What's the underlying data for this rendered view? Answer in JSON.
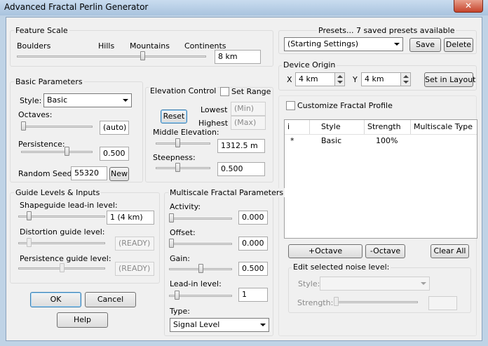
{
  "window": {
    "title": "Advanced Fractal Perlin Generator",
    "close_label": "✕"
  },
  "feature_scale": {
    "title": "Feature Scale",
    "ticks": [
      "Boulders",
      "Hills",
      "Mountains",
      "Continents"
    ],
    "value": "8 km",
    "slider_level": 0.67
  },
  "presets": {
    "title": "Presets... 7 saved presets available",
    "selected": "(Starting Settings)",
    "save_label": "Save",
    "delete_label": "Delete"
  },
  "device_origin": {
    "title": "Device Origin",
    "x_label": "X",
    "x_value": "4 km",
    "y_label": "Y",
    "y_value": "4 km",
    "set_in_layout_label": "Set in Layout"
  },
  "basic": {
    "title": "Basic Parameters",
    "style_label": "Style:",
    "style_value": "Basic",
    "octaves_label": "Octaves:",
    "octaves_value": "(auto)",
    "octaves_level": 0.0,
    "persistence_label": "Persistence:",
    "persistence_value": "0.500",
    "persistence_level": 0.65,
    "seed_label": "Random Seed:",
    "seed_value": "55320",
    "new_label": "New"
  },
  "elevation": {
    "title": "Elevation Control",
    "set_range_label": "Set Range",
    "reset_label": "Reset",
    "lowest_label": "Lowest",
    "lowest_value": "(Min)",
    "highest_label": "Highest",
    "highest_value": "(Max)",
    "middle_label": "Middle Elevation:",
    "middle_value": "1312.5 m",
    "middle_level": 0.4,
    "steepness_label": "Steepness:",
    "steepness_value": "0.500",
    "steepness_level": 0.4
  },
  "customize": {
    "label": "Customize Fractal Profile",
    "columns": [
      "i",
      "Style",
      "Strength",
      "Multiscale Type"
    ],
    "rows": [
      {
        "i": "*",
        "style": "Basic",
        "strength": "100%",
        "type": ""
      }
    ],
    "add_octave_label": "+Octave",
    "remove_octave_label": "-Octave",
    "clear_all_label": "Clear All",
    "edit_title": "Edit selected noise level:",
    "edit_style_label": "Style:",
    "edit_strength_label": "Strength:"
  },
  "guide": {
    "title": "Guide Levels & Inputs",
    "shapeguide_label": "Shapeguide lead-in level:",
    "shapeguide_value": "1 (4 km)",
    "shapeguide_level": 0.1,
    "distortion_label": "Distortion guide level:",
    "distortion_value": "(READY)",
    "distortion_level": 0.1,
    "persistence_guide_label": "Persistence guide level:",
    "persistence_guide_value": "(READY)",
    "persistence_guide_level": 0.5
  },
  "multiscale": {
    "title": "Multiscale Fractal Parameters",
    "activity_label": "Activity:",
    "activity_value": "0.000",
    "activity_level": 0.0,
    "offset_label": "Offset:",
    "offset_value": "0.000",
    "offset_level": 0.0,
    "gain_label": "Gain:",
    "gain_value": "0.500",
    "gain_level": 0.5,
    "leadin_label": "Lead-in level:",
    "leadin_value": "1",
    "leadin_level": 0.1,
    "type_label": "Type:",
    "type_value": "Signal Level"
  },
  "footer": {
    "ok_label": "OK",
    "cancel_label": "Cancel",
    "help_label": "Help"
  },
  "colors": {
    "title_bar": "#b9cfe6",
    "close_button": "#c6442b",
    "dialog_bg": "#f0f0f0"
  }
}
